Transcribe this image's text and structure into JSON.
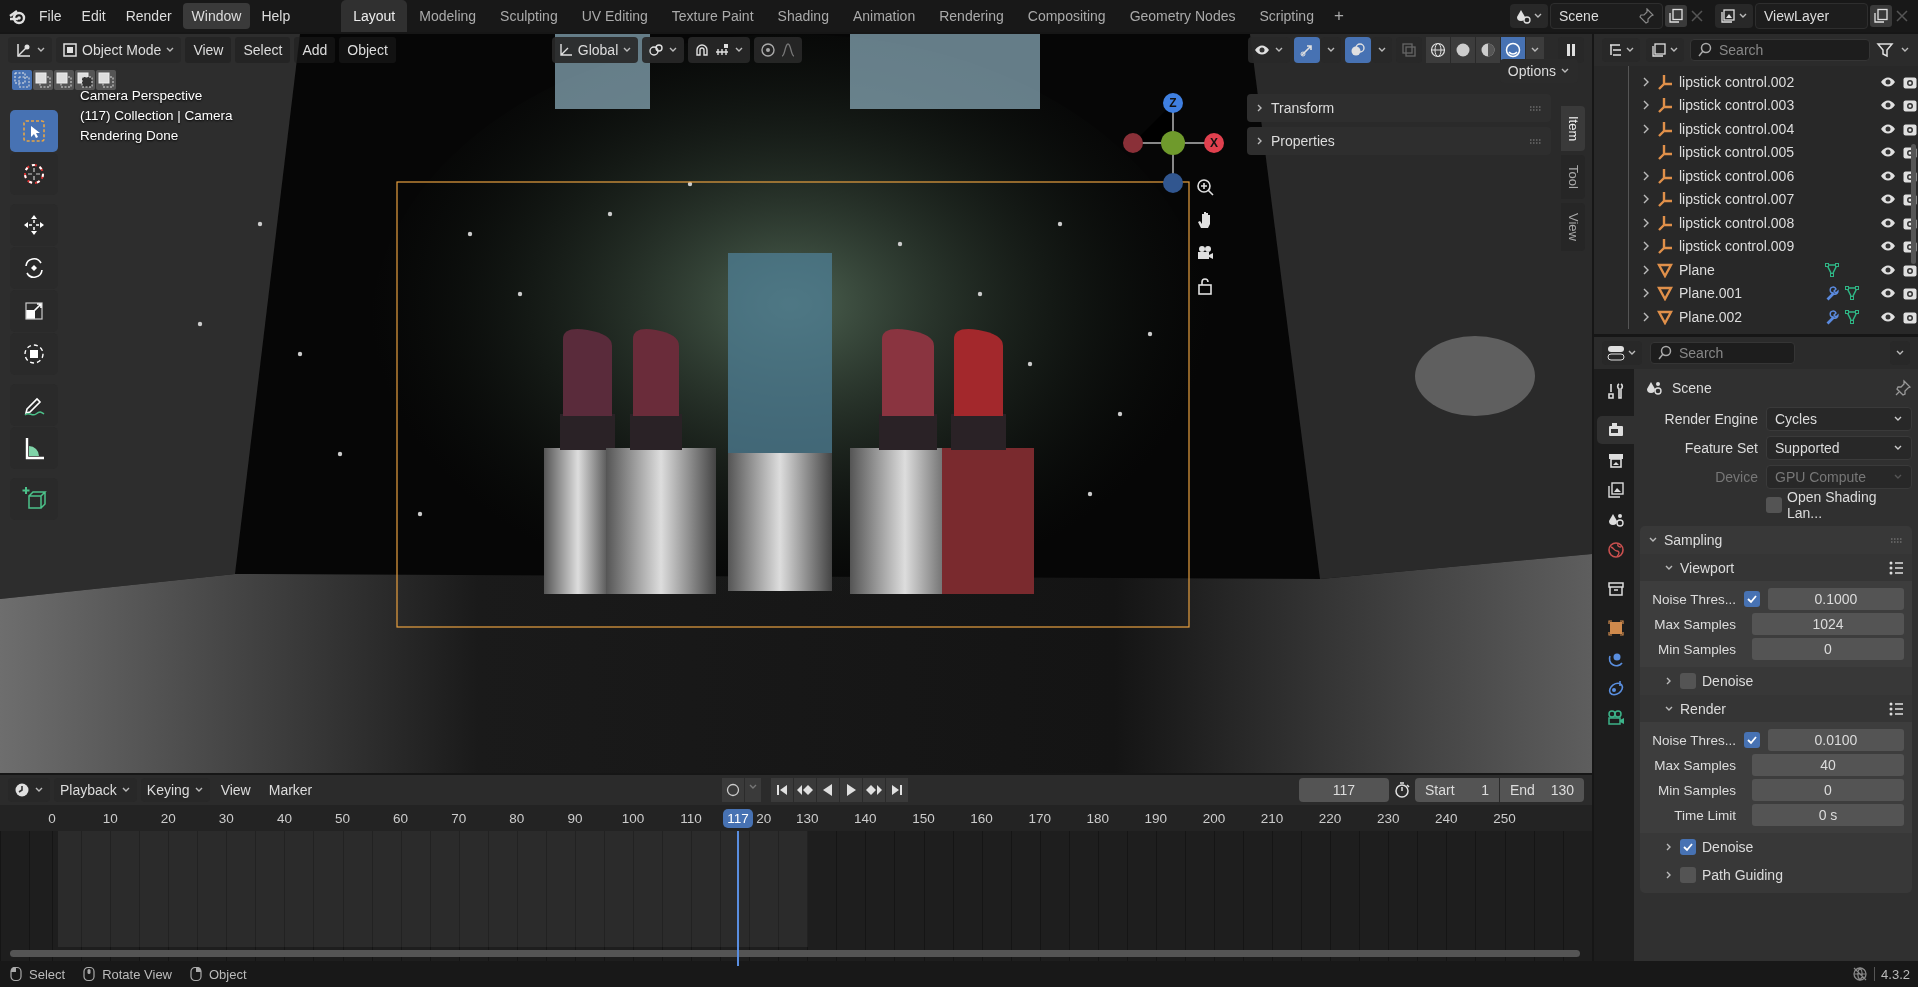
{
  "menu": [
    {
      "label": "File",
      "selected": false
    },
    {
      "label": "Edit",
      "selected": false
    },
    {
      "label": "Render",
      "selected": false
    },
    {
      "label": "Window",
      "selected": true
    },
    {
      "label": "Help",
      "selected": false
    }
  ],
  "workspaces": [
    {
      "label": "Layout",
      "selected": true
    },
    {
      "label": "Modeling",
      "selected": false
    },
    {
      "label": "Sculpting",
      "selected": false
    },
    {
      "label": "UV Editing",
      "selected": false
    },
    {
      "label": "Texture Paint",
      "selected": false
    },
    {
      "label": "Shading",
      "selected": false
    },
    {
      "label": "Animation",
      "selected": false
    },
    {
      "label": "Rendering",
      "selected": false
    },
    {
      "label": "Compositing",
      "selected": false
    },
    {
      "label": "Geometry Nodes",
      "selected": false
    },
    {
      "label": "Scripting",
      "selected": false
    }
  ],
  "add_workspace": "+",
  "scene": "Scene",
  "view_layer": "ViewLayer",
  "viewport": {
    "mode": "Object Mode",
    "menus": [
      "View",
      "Select",
      "Add",
      "Object"
    ],
    "orientation": "Global",
    "proportional_edit": false,
    "show_gizmos": true,
    "show_overlays": true,
    "xray": false,
    "shading": [
      {
        "selected": false
      },
      {
        "selected": false
      },
      {
        "selected": false
      },
      {
        "selected": true
      }
    ],
    "options": "Options",
    "select_modes": [
      {
        "selected": true
      },
      {
        "selected": false
      },
      {
        "selected": false
      },
      {
        "selected": false
      },
      {
        "selected": false
      }
    ],
    "tools": [
      {
        "kind": "select",
        "selected": true
      },
      {
        "kind": "cursor",
        "selected": false
      },
      {
        "kind": "move",
        "selected": false
      },
      {
        "kind": "rotate",
        "selected": false
      },
      {
        "kind": "scale",
        "selected": false
      },
      {
        "kind": "transform",
        "selected": false
      },
      {
        "kind": "annotate",
        "selected": false
      },
      {
        "kind": "measure",
        "selected": false
      },
      {
        "kind": "add_cube",
        "selected": false
      }
    ],
    "info": [
      "Camera Perspective",
      "(117) Collection | Camera",
      "Rendering Done"
    ],
    "gizmo": {
      "z": "Z",
      "x": "X"
    },
    "side_panels": [
      {
        "label": "Transform",
        "expanded": false
      },
      {
        "label": "Properties",
        "expanded": false
      }
    ],
    "side_tabs": [
      {
        "label": "Item",
        "selected": true
      },
      {
        "label": "Tool",
        "selected": false
      },
      {
        "label": "View",
        "selected": false
      }
    ]
  },
  "outliner": {
    "search": {
      "placeholder": "Search"
    },
    "rows": [
      {
        "name": "lipstick control.002",
        "kind": "empty",
        "expandable": true,
        "modifier": false,
        "mesh_data": false
      },
      {
        "name": "lipstick control.003",
        "kind": "empty",
        "expandable": true,
        "modifier": false,
        "mesh_data": false
      },
      {
        "name": "lipstick control.004",
        "kind": "empty",
        "expandable": true,
        "modifier": false,
        "mesh_data": false
      },
      {
        "name": "lipstick control.005",
        "kind": "empty",
        "expandable": false,
        "modifier": false,
        "mesh_data": false
      },
      {
        "name": "lipstick control.006",
        "kind": "empty",
        "expandable": true,
        "modifier": false,
        "mesh_data": false
      },
      {
        "name": "lipstick control.007",
        "kind": "empty",
        "expandable": true,
        "modifier": false,
        "mesh_data": false
      },
      {
        "name": "lipstick control.008",
        "kind": "empty",
        "expandable": true,
        "modifier": false,
        "mesh_data": false
      },
      {
        "name": "lipstick control.009",
        "kind": "empty",
        "expandable": true,
        "modifier": false,
        "mesh_data": false
      },
      {
        "name": "Plane",
        "kind": "mesh",
        "expandable": true,
        "modifier": false,
        "mesh_data": true
      },
      {
        "name": "Plane.001",
        "kind": "mesh",
        "expandable": true,
        "modifier": true,
        "mesh_data": true
      },
      {
        "name": "Plane.002",
        "kind": "mesh",
        "expandable": true,
        "modifier": true,
        "mesh_data": true
      }
    ]
  },
  "properties": {
    "search": {
      "placeholder": "Search"
    },
    "tabs": [
      {
        "kind": "tool",
        "selected": false
      },
      {
        "kind": "render",
        "selected": true
      },
      {
        "kind": "output",
        "selected": false
      },
      {
        "kind": "view_layer",
        "selected": false
      },
      {
        "kind": "scene",
        "selected": false
      },
      {
        "kind": "world",
        "selected": false
      },
      {
        "kind": "collection",
        "selected": false
      },
      {
        "kind": "object",
        "selected": false
      },
      {
        "kind": "physics",
        "selected": false
      },
      {
        "kind": "constraints",
        "selected": false
      },
      {
        "kind": "data",
        "selected": false
      }
    ],
    "context": "Scene",
    "fields": [
      {
        "kind": "dropdown",
        "label": "Render Engine",
        "value": "Cycles",
        "disabled": false
      },
      {
        "kind": "dropdown",
        "label": "Feature Set",
        "value": "Supported",
        "disabled": false
      },
      {
        "kind": "dropdown",
        "label": "Device",
        "value": "GPU Compute",
        "disabled": true
      },
      {
        "kind": "checkbox",
        "label": "Open Shading Lan...",
        "checked": false
      }
    ],
    "sampling": {
      "title": "Sampling",
      "expanded": true,
      "items": [
        {
          "kind": "subpanel",
          "title": "Viewport",
          "expanded": true,
          "rows": [
            {
              "kind": "check_number",
              "label": "Noise Thres...",
              "checked": true,
              "value": "0.1000"
            },
            {
              "kind": "number",
              "label": "Max Samples",
              "value": "1024"
            },
            {
              "kind": "number",
              "label": "Min Samples",
              "value": "0"
            }
          ]
        },
        {
          "kind": "toggle_subpanel",
          "label": "Denoise",
          "checked": false,
          "expanded": false
        },
        {
          "kind": "subpanel",
          "title": "Render",
          "expanded": true,
          "rows": [
            {
              "kind": "check_number",
              "label": "Noise Thres...",
              "checked": true,
              "value": "0.0100"
            },
            {
              "kind": "number",
              "label": "Max Samples",
              "value": "40"
            },
            {
              "kind": "number",
              "label": "Min Samples",
              "value": "0"
            },
            {
              "kind": "number",
              "label": "Time Limit",
              "value": "0 s"
            }
          ]
        },
        {
          "kind": "toggle_subpanel",
          "label": "Denoise",
          "checked": true,
          "expanded": false
        },
        {
          "kind": "toggle_subpanel",
          "label": "Path Guiding",
          "checked": false,
          "expanded": false
        }
      ]
    }
  },
  "timeline": {
    "menus": [
      {
        "label": "Playback",
        "kind": "dropdown"
      },
      {
        "label": "Keying",
        "kind": "dropdown"
      },
      {
        "label": "View",
        "kind": "menu"
      },
      {
        "label": "Marker",
        "kind": "menu"
      }
    ],
    "auto_keying": false,
    "current_frame": "117",
    "start": {
      "label": "Start",
      "value": "1"
    },
    "end": {
      "label": "End",
      "value": "130"
    },
    "ruler": [
      {
        "kind": "tick",
        "label": "0"
      },
      {
        "kind": "tick",
        "label": "10"
      },
      {
        "kind": "tick",
        "label": "20"
      },
      {
        "kind": "tick",
        "label": "30"
      },
      {
        "kind": "tick",
        "label": "40"
      },
      {
        "kind": "tick",
        "label": "50"
      },
      {
        "kind": "tick",
        "label": "60"
      },
      {
        "kind": "tick",
        "label": "70"
      },
      {
        "kind": "tick",
        "label": "80"
      },
      {
        "kind": "tick",
        "label": "90"
      },
      {
        "kind": "tick",
        "label": "100"
      },
      {
        "kind": "tick",
        "label": "110"
      },
      {
        "kind": "playhead",
        "label": "117"
      },
      {
        "kind": "partial",
        "label": "20"
      },
      {
        "kind": "tick",
        "label": "130"
      },
      {
        "kind": "tick",
        "label": "140"
      },
      {
        "kind": "tick",
        "label": "150"
      },
      {
        "kind": "tick",
        "label": "160"
      },
      {
        "kind": "tick",
        "label": "170"
      },
      {
        "kind": "tick",
        "label": "180"
      },
      {
        "kind": "tick",
        "label": "190"
      },
      {
        "kind": "tick",
        "label": "200"
      },
      {
        "kind": "tick",
        "label": "210"
      },
      {
        "kind": "tick",
        "label": "220"
      },
      {
        "kind": "tick",
        "label": "230"
      },
      {
        "kind": "tick",
        "label": "240"
      },
      {
        "kind": "tick",
        "label": "250"
      }
    ]
  },
  "status_bar": {
    "hints": [
      {
        "label": "Select",
        "kind": "left"
      },
      {
        "label": "Rotate View",
        "kind": "middle"
      },
      {
        "label": "Object",
        "kind": "right"
      }
    ],
    "version": "4.3.2"
  }
}
